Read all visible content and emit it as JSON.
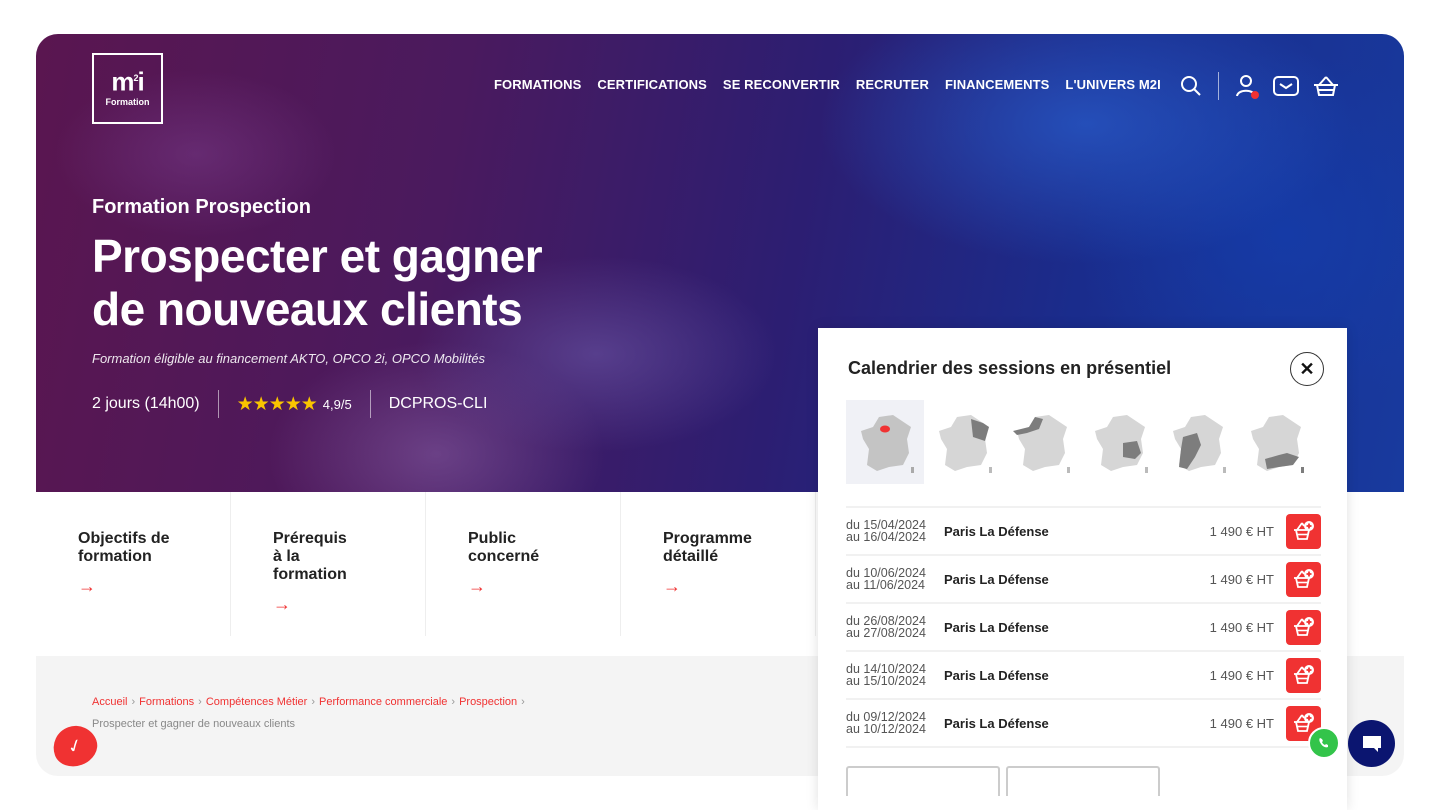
{
  "logo": {
    "mark": "m",
    "mark_sup": "2",
    "mark_end": "i",
    "sub": "Formation"
  },
  "nav": {
    "items": [
      "FORMATIONS",
      "CERTIFICATIONS",
      "SE RECONVERTIR",
      "RECRUTER",
      "FINANCEMENTS",
      "L'UNIVERS M2I"
    ],
    "icons": [
      "search-icon",
      "user-icon",
      "mail-icon",
      "basket-icon"
    ]
  },
  "hero": {
    "eyebrow": "Formation Prospection",
    "title_line1": "Prospecter et gagner",
    "title_line2": "de nouveaux clients",
    "subtitle": "Formation éligible au financement AKTO, OPCO  2i, OPCO Mobilités",
    "duration": "2 jours  (14h00)",
    "stars": "★★★★★",
    "rating": "4,9/5",
    "rating_value": 4.9,
    "code": "DCPROS-CLI"
  },
  "tabs": [
    {
      "label": "Objectifs de formation",
      "arrow": "→"
    },
    {
      "label": "Prérequis à la formation",
      "arrow": "→"
    },
    {
      "label": "Public concerné",
      "arrow": "→"
    },
    {
      "label": "Programme détaillé",
      "arrow": "→"
    }
  ],
  "breadcrumb": {
    "items": [
      "Accueil",
      "Formations",
      "Compétences Métier",
      "Performance commerciale",
      "Prospection"
    ],
    "separator": "›",
    "current": "Prospecter et gagner de nouveaux clients"
  },
  "popup": {
    "title": "Calendrier des sessions en présentiel",
    "close": "✕",
    "maps": [
      {
        "region": "Île-de-France",
        "active": true
      },
      {
        "region": "Grand Est",
        "active": false
      },
      {
        "region": "Normandie / Hauts-de-France",
        "active": false
      },
      {
        "region": "Auvergne-Rhône-Alpes",
        "active": false
      },
      {
        "region": "Nouvelle-Aquitaine",
        "active": false
      },
      {
        "region": "Occitanie / PACA",
        "active": false
      }
    ],
    "sessions": [
      {
        "from": "du 15/04/2024",
        "to": "au 16/04/2024",
        "place": "Paris La Défense",
        "price": "1 490 € HT"
      },
      {
        "from": "du 10/06/2024",
        "to": "au 11/06/2024",
        "place": "Paris La Défense",
        "price": "1 490 € HT"
      },
      {
        "from": "du 26/08/2024",
        "to": "au 27/08/2024",
        "place": "Paris La Défense",
        "price": "1 490 € HT"
      },
      {
        "from": "du 14/10/2024",
        "to": "au 15/10/2024",
        "place": "Paris La Défense",
        "price": "1 490 € HT"
      },
      {
        "from": "du 09/12/2024",
        "to": "au 10/12/2024",
        "place": "Paris La Défense",
        "price": "1 490 € HT"
      }
    ]
  },
  "colors": {
    "accent": "#f03232",
    "star": "#f9c500",
    "chat": "#0b1570",
    "whatsapp": "#33c44a"
  }
}
